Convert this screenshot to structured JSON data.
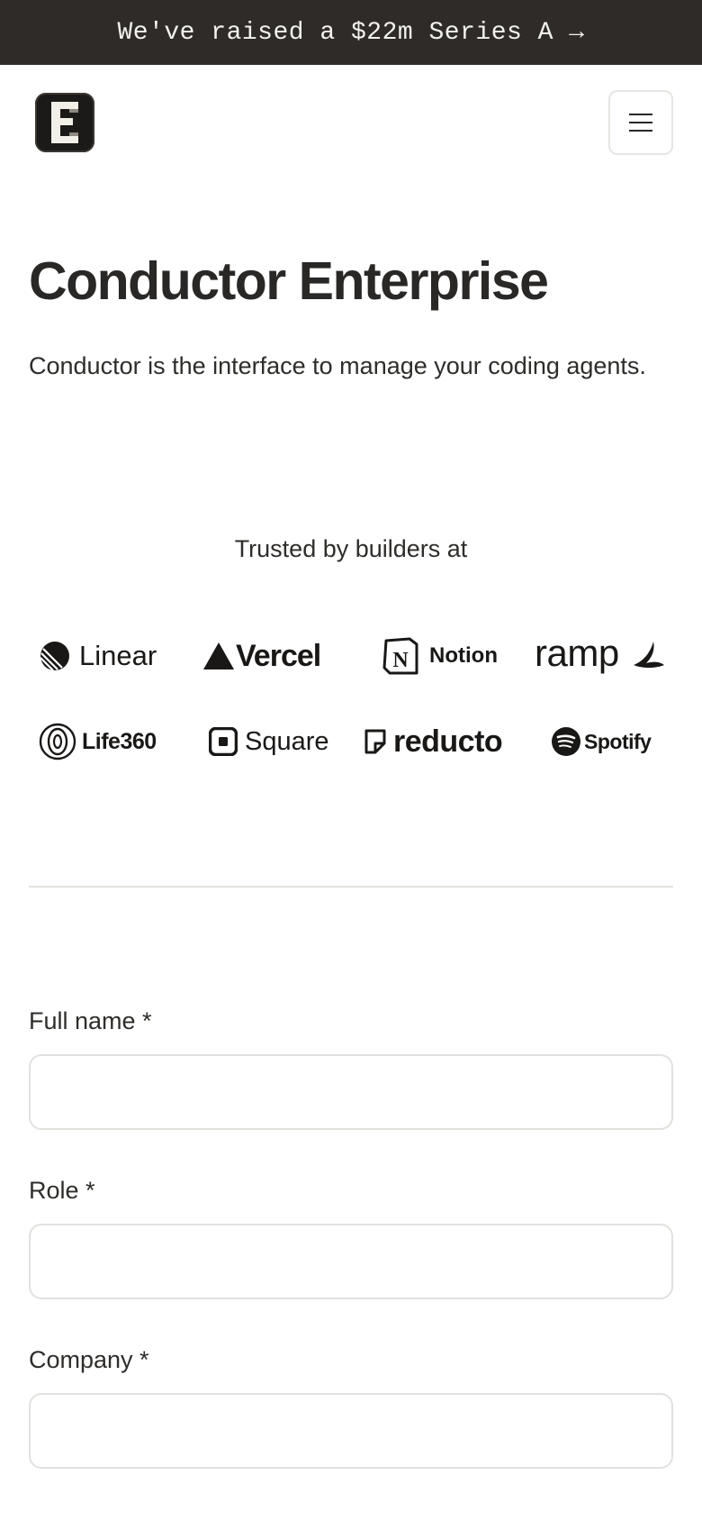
{
  "announcement": {
    "text": "We've raised a $22m Series A →"
  },
  "header": {
    "logo_name": "conductor-logo",
    "menu_icon": "hamburger-menu-icon"
  },
  "hero": {
    "title": "Conductor Enterprise",
    "subtitle": "Conductor is the interface to manage your coding agents."
  },
  "trusted": {
    "heading": "Trusted by builders at",
    "logos": [
      "Linear",
      "Vercel",
      "Notion",
      "ramp",
      "Life360",
      "Square",
      "reducto",
      "Spotify"
    ]
  },
  "form": {
    "fields": [
      {
        "label": "Full name *",
        "value": ""
      },
      {
        "label": "Role *",
        "value": ""
      },
      {
        "label": "Company *",
        "value": ""
      }
    ]
  },
  "colors": {
    "banner_bg": "#2e2b28",
    "text": "#2a2826",
    "border": "#e3e1de"
  }
}
